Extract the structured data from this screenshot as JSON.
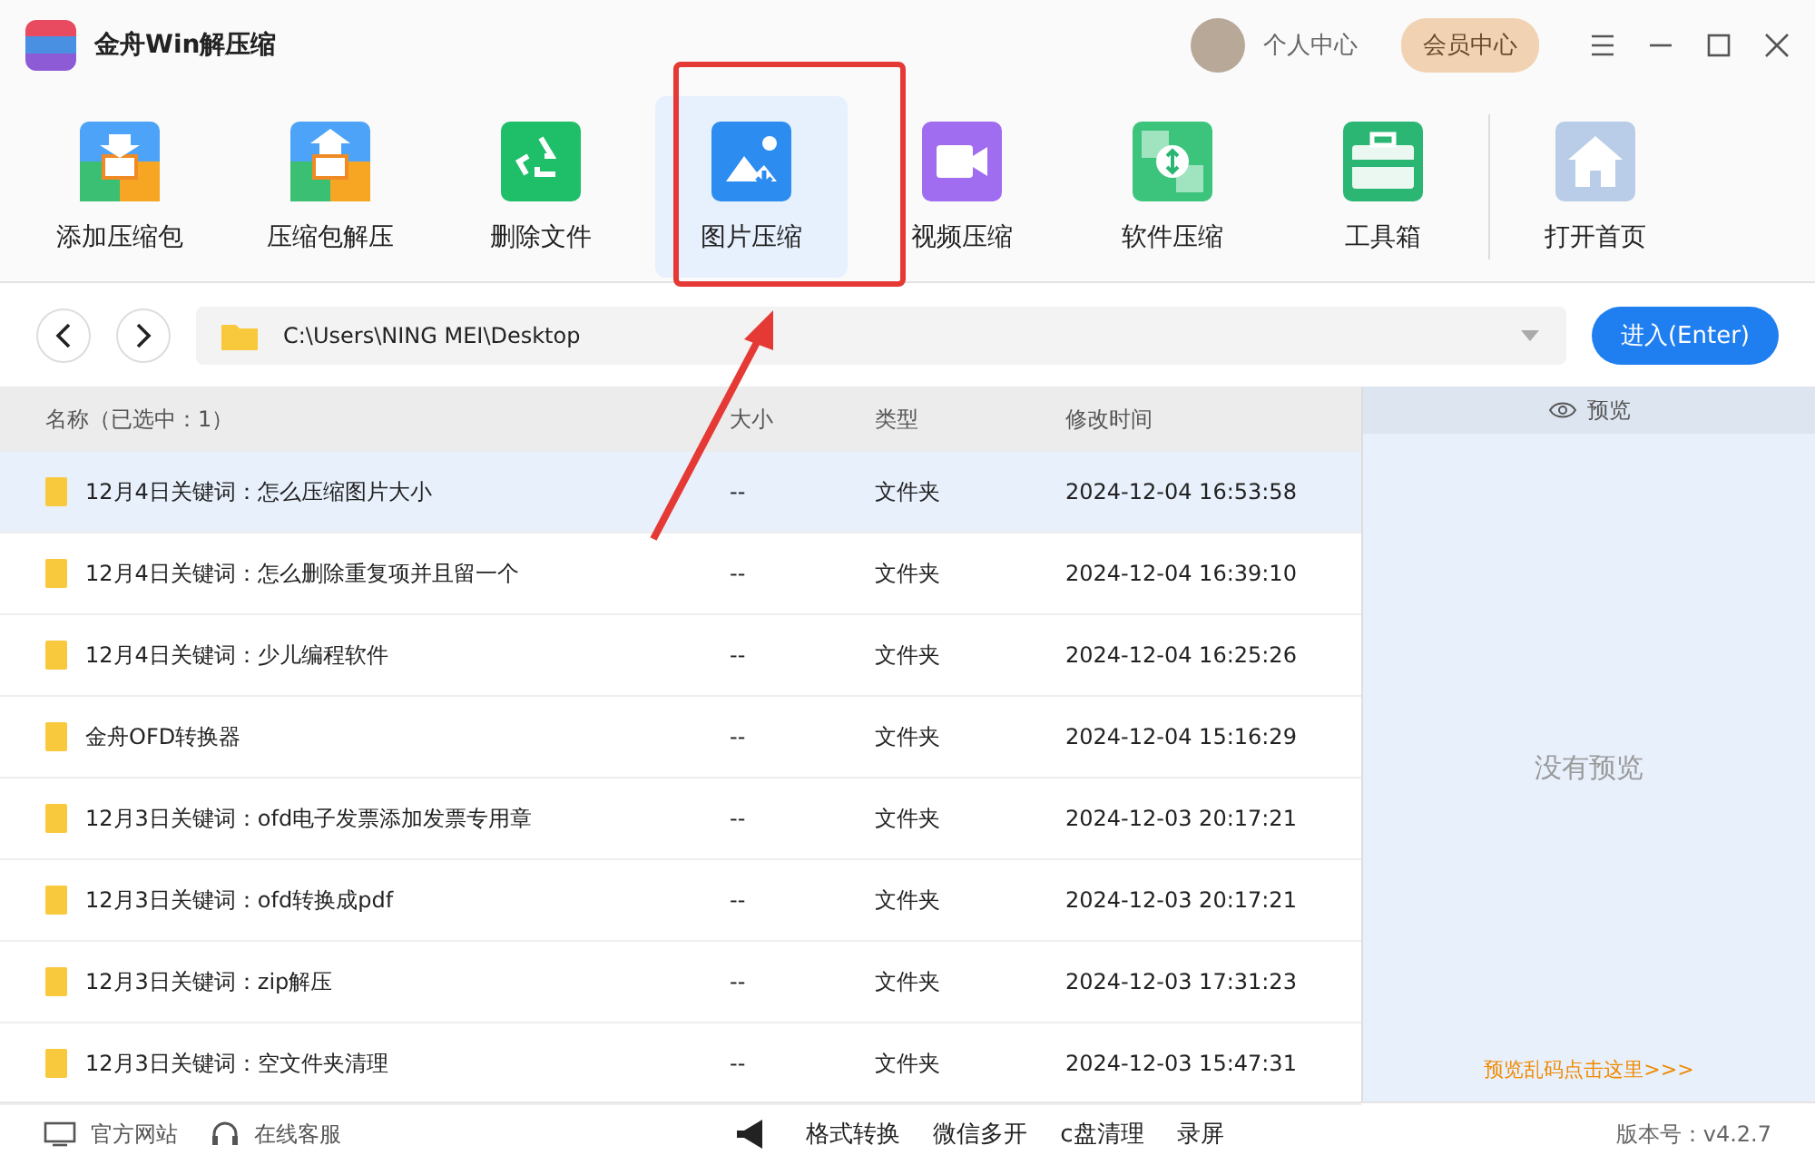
{
  "app": {
    "title": "金舟Win解压缩",
    "user": "个人中心",
    "vip": "会员中心"
  },
  "tools": [
    {
      "label": "添加压缩包",
      "kind": "add",
      "selected": false
    },
    {
      "label": "压缩包解压",
      "kind": "extract",
      "selected": false
    },
    {
      "label": "删除文件",
      "kind": "delete",
      "selected": false
    },
    {
      "label": "图片压缩",
      "kind": "image",
      "selected": true
    },
    {
      "label": "视频压缩",
      "kind": "video",
      "selected": false
    },
    {
      "label": "软件压缩",
      "kind": "software",
      "selected": false
    },
    {
      "label": "工具箱",
      "kind": "toolbox",
      "selected": false
    },
    {
      "label": "打开首页",
      "kind": "home",
      "selected": false
    }
  ],
  "path": {
    "value": "C:\\Users\\NING MEI\\Desktop",
    "enter": "进入(Enter)"
  },
  "table": {
    "columns": [
      "名称（已选中：1）",
      "大小",
      "类型",
      "修改时间"
    ],
    "rows": [
      {
        "name": "12月4日关键词：怎么压缩图片大小",
        "size": "--",
        "type": "文件夹",
        "modified": "2024-12-04 16:53:58",
        "selected": true
      },
      {
        "name": "12月4日关键词：怎么删除重复项并且留一个",
        "size": "--",
        "type": "文件夹",
        "modified": "2024-12-04 16:39:10",
        "selected": false
      },
      {
        "name": "12月4日关键词：少儿编程软件",
        "size": "--",
        "type": "文件夹",
        "modified": "2024-12-04 16:25:26",
        "selected": false
      },
      {
        "name": "金舟OFD转换器",
        "size": "--",
        "type": "文件夹",
        "modified": "2024-12-04 15:16:29",
        "selected": false
      },
      {
        "name": "12月3日关键词：ofd电子发票添加发票专用章",
        "size": "--",
        "type": "文件夹",
        "modified": "2024-12-03 20:17:21",
        "selected": false
      },
      {
        "name": "12月3日关键词：ofd转换成pdf",
        "size": "--",
        "type": "文件夹",
        "modified": "2024-12-03 20:17:21",
        "selected": false
      },
      {
        "name": "12月3日关键词：zip解压",
        "size": "--",
        "type": "文件夹",
        "modified": "2024-12-03 17:31:23",
        "selected": false
      },
      {
        "name": "12月3日关键词：空文件夹清理",
        "size": "--",
        "type": "文件夹",
        "modified": "2024-12-03 15:47:31",
        "selected": false
      }
    ]
  },
  "preview": {
    "title": "预览",
    "empty": "没有预览",
    "help": "预览乱码点击这里>>>"
  },
  "footer": {
    "links": [
      "官方网站",
      "在线客服"
    ],
    "tools": [
      "格式转换",
      "微信多开",
      "c盘清理",
      "录屏"
    ],
    "version": "版本号：v4.2.7"
  }
}
